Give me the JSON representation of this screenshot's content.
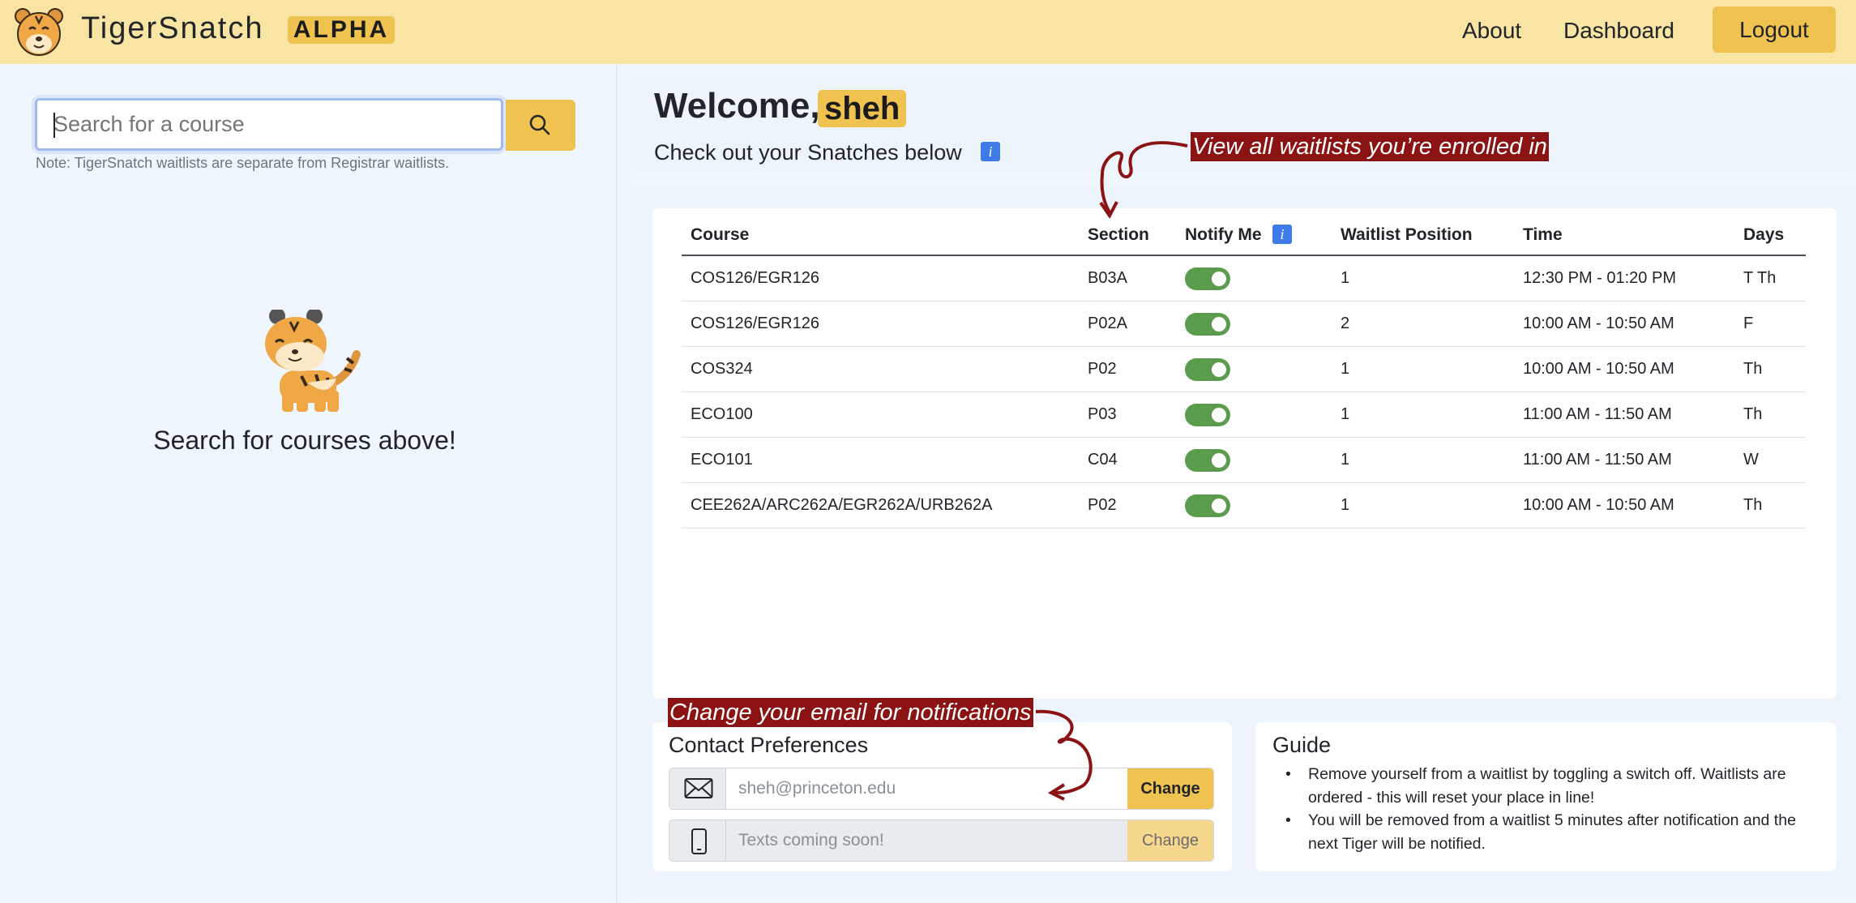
{
  "navbar": {
    "brand": "TigerSnatch",
    "badge": "ALPHA",
    "links": [
      "About",
      "Dashboard"
    ],
    "logout": "Logout"
  },
  "search": {
    "placeholder": "Search for a course",
    "note": "Note: TigerSnatch waitlists are separate from Registrar waitlists.",
    "empty_message": "Search for courses above!"
  },
  "welcome": {
    "greeting": "Welcome,",
    "username": "sheh",
    "subtitle": "Check out your Snatches below",
    "info_icon": "i"
  },
  "table": {
    "columns": [
      "Course",
      "Section",
      "Notify Me",
      "Waitlist Position",
      "Time",
      "Days"
    ],
    "rows": [
      {
        "course": "COS126/EGR126",
        "section": "B03A",
        "notify": true,
        "position": "1",
        "time": "12:30 PM - 01:20 PM",
        "days": "T Th"
      },
      {
        "course": "COS126/EGR126",
        "section": "P02A",
        "notify": true,
        "position": "2",
        "time": "10:00 AM - 10:50 AM",
        "days": "F"
      },
      {
        "course": "COS324",
        "section": "P02",
        "notify": true,
        "position": "1",
        "time": "10:00 AM - 10:50 AM",
        "days": "Th"
      },
      {
        "course": "ECO100",
        "section": "P03",
        "notify": true,
        "position": "1",
        "time": "11:00 AM - 11:50 AM",
        "days": "Th"
      },
      {
        "course": "ECO101",
        "section": "C04",
        "notify": true,
        "position": "1",
        "time": "11:00 AM - 11:50 AM",
        "days": "W"
      },
      {
        "course": "CEE262A/ARC262A/EGR262A/URB262A",
        "section": "P02",
        "notify": true,
        "position": "1",
        "time": "10:00 AM - 10:50 AM",
        "days": "Th"
      }
    ]
  },
  "annotations": {
    "waitlists": "View all waitlists you’re enrolled in",
    "email": "Change your email for notifications"
  },
  "contact": {
    "title": "Contact Preferences",
    "email_value": "sheh@princeton.edu",
    "phone_placeholder": "Texts coming soon!",
    "change_label": "Change"
  },
  "guide": {
    "title": "Guide",
    "items": [
      "Remove yourself from a waitlist by toggling a switch off. Waitlists are ordered - this will reset your place in line!",
      "You will be removed from a waitlist 5 minutes after notification and the next Tiger will be notified."
    ]
  },
  "colors": {
    "navbar_bg": "#f9e5a3",
    "accent_yellow": "#f0c24f",
    "toggle_green": "#5a9b4c",
    "annotation_red": "#8b1313",
    "info_blue": "#3e7be8"
  },
  "icons": [
    "tiger-logo-icon",
    "search-icon",
    "info-icon",
    "envelope-icon",
    "phone-icon",
    "tiger-illustration"
  ]
}
